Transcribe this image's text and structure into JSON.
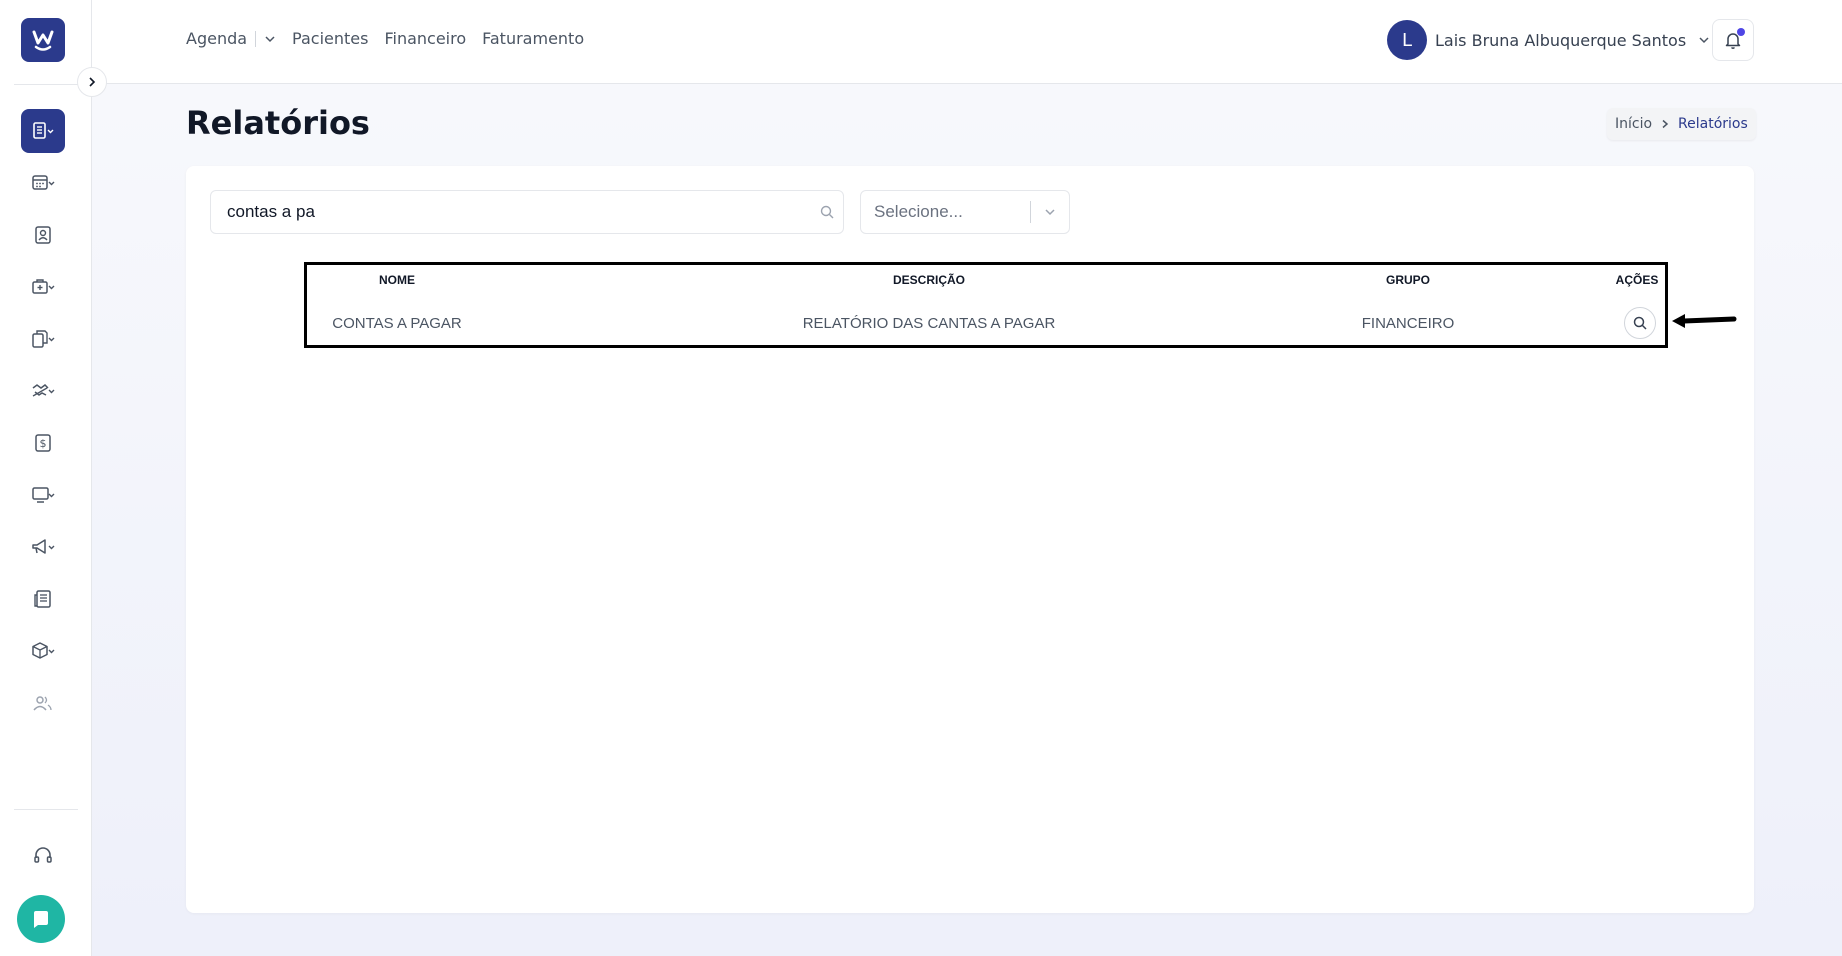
{
  "app": {
    "logo_letter": "W"
  },
  "sidebar": {
    "items": [
      {
        "name": "reports-icon",
        "active": true
      },
      {
        "name": "calendar-icon"
      },
      {
        "name": "patient-id-icon"
      },
      {
        "name": "medical-bag-icon"
      },
      {
        "name": "documents-icon"
      },
      {
        "name": "handshake-icon"
      },
      {
        "name": "dollar-icon"
      },
      {
        "name": "monitor-icon"
      },
      {
        "name": "megaphone-icon"
      },
      {
        "name": "newspaper-icon"
      },
      {
        "name": "box-icon"
      },
      {
        "name": "users-icon"
      },
      {
        "name": "headset-icon"
      }
    ]
  },
  "topnav": {
    "agenda": "Agenda",
    "pacientes": "Pacientes",
    "financeiro": "Financeiro",
    "faturamento": "Faturamento"
  },
  "user": {
    "initial": "L",
    "name": "Lais Bruna Albuquerque Santos"
  },
  "page": {
    "title": "Relatórios"
  },
  "breadcrumb": {
    "home": "Início",
    "current": "Relatórios"
  },
  "filters": {
    "search_value": "contas a pa",
    "select_placeholder": "Selecione..."
  },
  "table": {
    "headers": {
      "nome": "NOME",
      "descricao": "DESCRIÇÃO",
      "grupo": "GRUPO",
      "acoes": "AÇÕES"
    },
    "rows": [
      {
        "nome": "CONTAS A PAGAR",
        "descricao": "RELATÓRIO DAS CANTAS A PAGAR",
        "grupo": "FINANCEIRO"
      }
    ]
  },
  "colors": {
    "brand": "#2b3a8c",
    "chat": "#1fb6a4",
    "notification_dot": "#4f46e5"
  }
}
